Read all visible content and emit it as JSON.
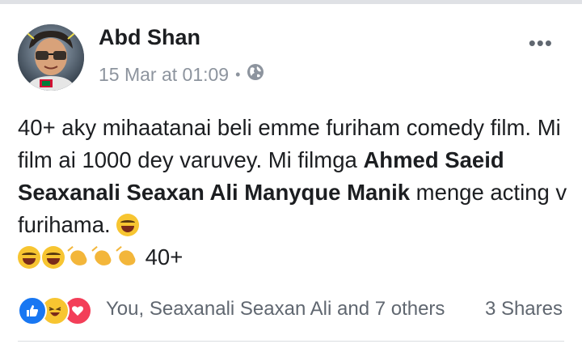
{
  "post": {
    "author": "Abd Shan",
    "timestamp": "15 Mar at 01:09",
    "separator": "•",
    "privacy_icon": "globe-icon",
    "menu_icon": "more-options-icon",
    "body_parts": [
      "40+ aky mihaatanai beli emme furiham comedy film. Mi film ai 1000 dey varuvey. Mi filmga ",
      "Ahmed Saeid Seaxanali Seaxan Ali Manyque Manik",
      " menge acting v furihama. ",
      " 40+"
    ],
    "emojis_line1": [
      "face-with-tears-of-joy"
    ],
    "emojis_line2": [
      "face-with-tears-of-joy",
      "face-with-tears-of-joy",
      "clapping-hands",
      "clapping-hands",
      "clapping-hands"
    ]
  },
  "footer": {
    "reaction_icons": [
      "like-icon",
      "haha-icon",
      "love-icon"
    ],
    "reactions_text": "You, Seaxanali Seaxan Ali and 7 others",
    "shares_text": "3 Shares"
  },
  "colors": {
    "text": "#1c1e21",
    "meta": "#8d949e",
    "like": "#1877f2",
    "love": "#f33e58",
    "haha": "#f7c531"
  }
}
